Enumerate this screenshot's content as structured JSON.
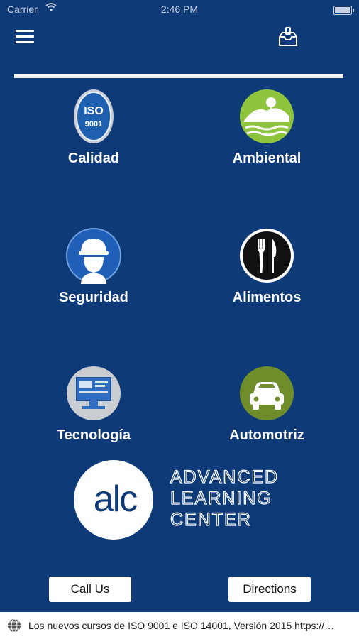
{
  "status_bar": {
    "carrier": "Carrier",
    "time": "2:46 PM",
    "battery_level": 0.9
  },
  "header": {
    "menu_icon": "menu-icon",
    "inbox_icon": "inbox-icon"
  },
  "categories": [
    {
      "label": "Calidad",
      "icon": "iso-9001-icon",
      "icon_text_1": "ISO",
      "icon_text_2": "9001"
    },
    {
      "label": "Ambiental",
      "icon": "environment-icon"
    },
    {
      "label": "Seguridad",
      "icon": "safety-helmet-icon"
    },
    {
      "label": "Alimentos",
      "icon": "fork-knife-icon"
    },
    {
      "label": "Tecnología",
      "icon": "computer-icon"
    },
    {
      "label": "Automotriz",
      "icon": "car-icon"
    }
  ],
  "logo": {
    "mark": "alc",
    "line1": "ADVANCED",
    "line2": "LEARNING",
    "line3": "CENTER"
  },
  "buttons": {
    "call": "Call Us",
    "directions": "Directions"
  },
  "news": {
    "text": "Los nuevos cursos de ISO 9001 e ISO 14001, Versión 2015 https://…",
    "icon": "globe-icon"
  }
}
